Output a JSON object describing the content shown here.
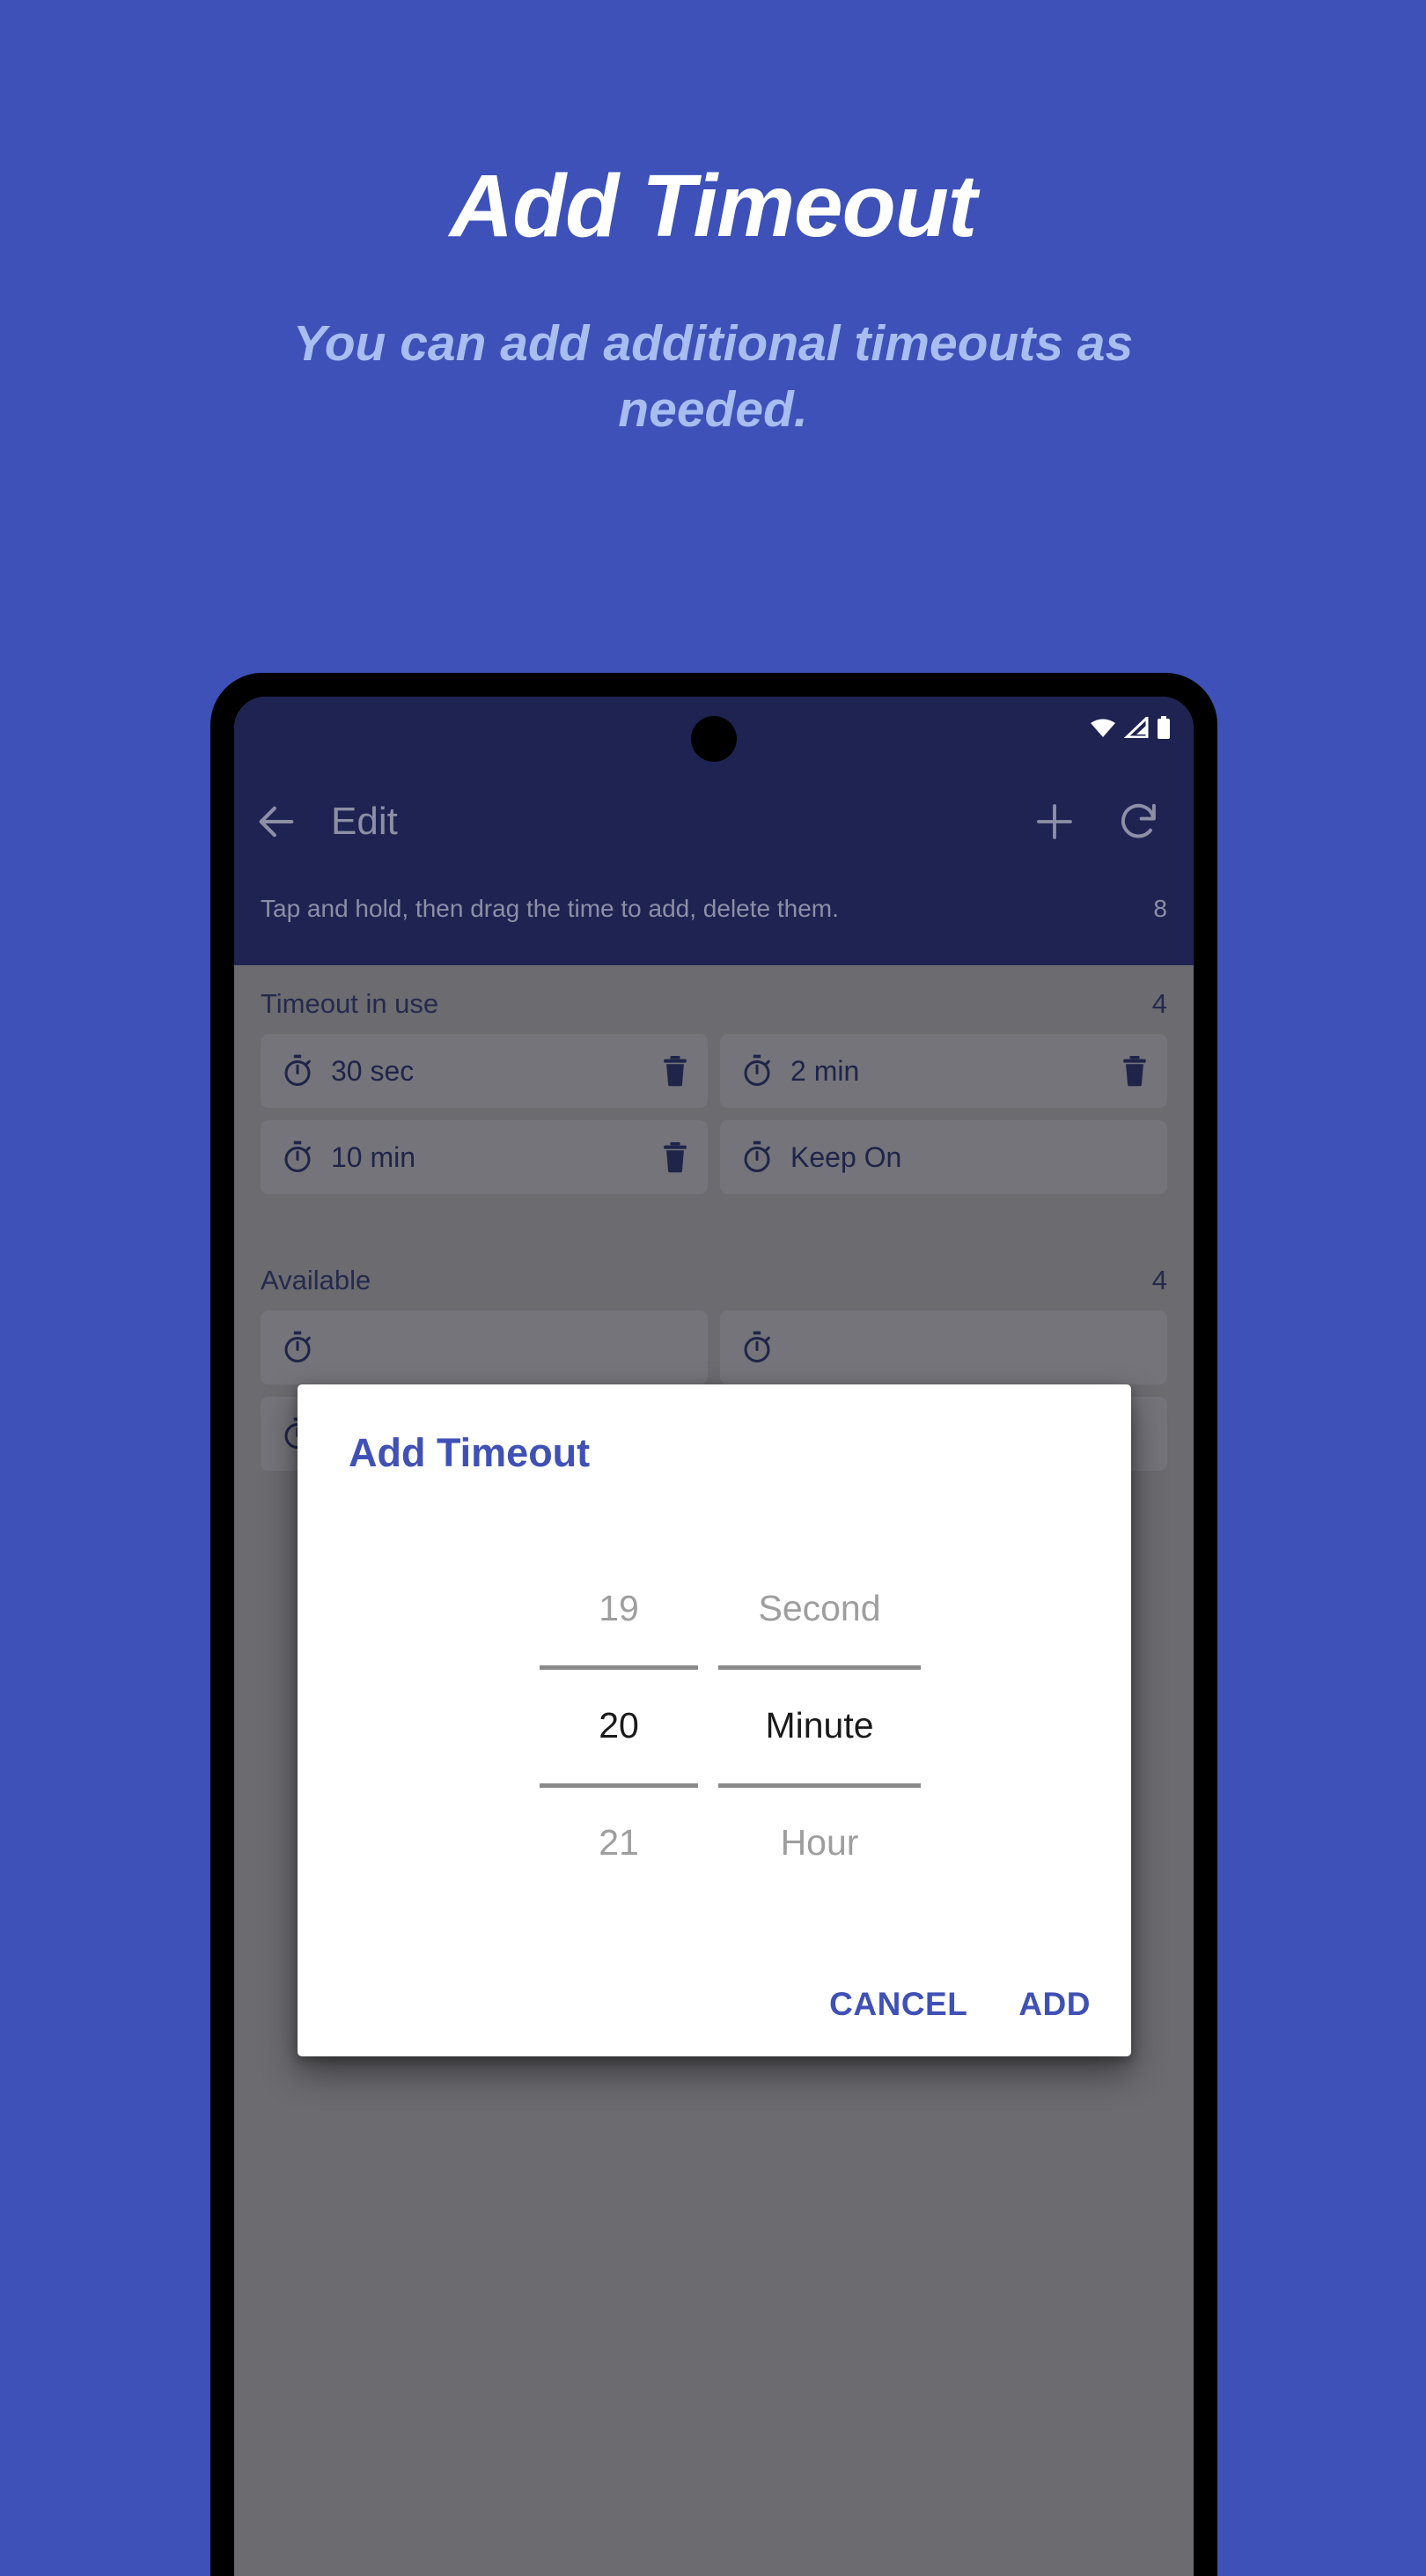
{
  "promo": {
    "title": "Add Timeout",
    "subtitle": "You can add additional timeouts as needed."
  },
  "colors": {
    "background": "#3d51b8",
    "promo_title": "#ffffff",
    "promo_subtitle": "#a8bdf0",
    "appbar": "#1e2352",
    "accent": "#3f51b5",
    "scrim_gray": "#6b6b70",
    "card": "#74747a",
    "icon_navy": "#1f2449"
  },
  "statusbar": {
    "icons": [
      "wifi-icon",
      "signal-icon",
      "battery-icon"
    ]
  },
  "appbar": {
    "back_icon": "back-arrow-icon",
    "title": "Edit",
    "add_icon": "plus-icon",
    "refresh_icon": "refresh-icon",
    "hint": "Tap and hold, then drag the time to add, delete them.",
    "hint_count": "8"
  },
  "in_use": {
    "header": "Timeout in use",
    "count": "4",
    "items": [
      {
        "label": "30 sec",
        "icon": "stopwatch-icon",
        "deletable": true,
        "delete_icon": "trash-icon"
      },
      {
        "label": "2 min",
        "icon": "stopwatch-icon",
        "deletable": true,
        "delete_icon": "trash-icon"
      },
      {
        "label": "10 min",
        "icon": "stopwatch-icon",
        "deletable": true,
        "delete_icon": "trash-icon"
      },
      {
        "label": "Keep On",
        "icon": "stopwatch-icon",
        "deletable": false,
        "delete_icon": ""
      }
    ]
  },
  "available": {
    "header": "Available",
    "count": "4"
  },
  "dialog": {
    "title": "Add Timeout",
    "number_picker": {
      "previous": "19",
      "selected": "20",
      "next": "21"
    },
    "unit_picker": {
      "previous": "Second",
      "selected": "Minute",
      "next": "Hour"
    },
    "cancel_label": "CANCEL",
    "add_label": "ADD"
  }
}
